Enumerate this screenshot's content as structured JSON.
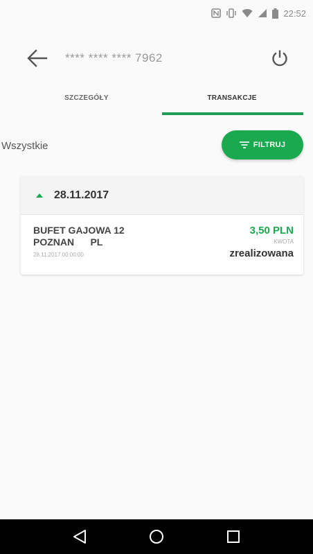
{
  "status_bar": {
    "time": "22:52",
    "icons": [
      "nfc-icon",
      "vibrate-icon",
      "wifi-icon",
      "signal-icon",
      "battery-icon"
    ]
  },
  "header": {
    "card_number": "**** **** **** 7962",
    "back_icon": "arrow-left-icon",
    "power_icon": "power-icon"
  },
  "tabs": [
    {
      "label": "SZCZEGÓŁY",
      "active": false
    },
    {
      "label": "TRANSAKCJE",
      "active": true
    }
  ],
  "filter": {
    "label": "Wszystkie",
    "button_label": "FILTRUJ",
    "button_icon": "filter-icon"
  },
  "transactions": [
    {
      "date": "28.11.2017",
      "merchant": "BUFET GAJOWA 12\nPOZNAN      PL",
      "datetime": "28.11.2017 00:00:00",
      "amount": "3,50 PLN",
      "amount_label": "KWOTA",
      "status": "zrealizowana"
    }
  ],
  "colors": {
    "accent": "#1aa94f",
    "tab_underline": "#1f9d55"
  }
}
